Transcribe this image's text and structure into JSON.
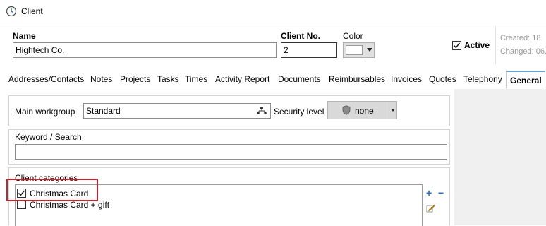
{
  "window": {
    "title": "Client"
  },
  "header": {
    "name_label": "Name",
    "name_value": "Hightech Co.",
    "client_no_label": "Client No.",
    "client_no_value": "2",
    "color_label": "Color",
    "active_label": "Active",
    "active_checked": true,
    "created_text": "Created: 18.",
    "changed_text": "Changed: 06."
  },
  "tabs": [
    "Addresses/Contacts",
    "Notes",
    "Projects",
    "Tasks",
    "Times",
    "Activity Report",
    "Documents",
    "Reimbursables",
    "Invoices",
    "Quotes",
    "Telephony",
    "General"
  ],
  "active_tab": "General",
  "general": {
    "main_workgroup_label": "Main workgroup",
    "main_workgroup_value": "Standard",
    "security_level_label": "Security level",
    "security_level_value": "none",
    "keyword_label": "Keyword / Search",
    "keyword_value": "",
    "categories_label": "Client categories",
    "categories": [
      {
        "label": "Christmas Card",
        "checked": true
      },
      {
        "label": "Christmas Card + gift",
        "checked": false
      }
    ]
  },
  "colors": {
    "tab_active_accent": "#6aa0d8",
    "highlight": "#c1272d"
  }
}
